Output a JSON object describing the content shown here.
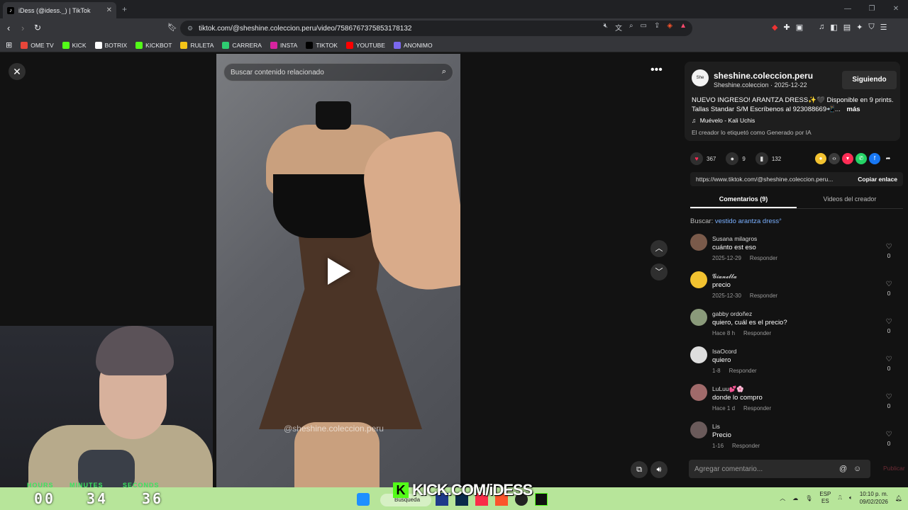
{
  "browser": {
    "tab_title": "iDess (@idess._) | TikTok",
    "url": "tiktok.com/@sheshine.coleccion.peru/video/7586767375853178132"
  },
  "bookmarks": [
    {
      "label": "OME TV",
      "color": "#e8463a"
    },
    {
      "label": "KICK",
      "color": "#53fc18"
    },
    {
      "label": "BOTRIX",
      "color": "#ffffff"
    },
    {
      "label": "KICKBOT",
      "color": "#53fc18"
    },
    {
      "label": "RULETA",
      "color": "#f5c518"
    },
    {
      "label": "CARRERA",
      "color": "#2ecc71"
    },
    {
      "label": "INSTA",
      "color": "#d6249f"
    },
    {
      "label": "TIKTOK",
      "color": "#000000"
    },
    {
      "label": "YOUTUBE",
      "color": "#ff0000"
    },
    {
      "label": "ANONIMO",
      "color": "#7b68ee"
    }
  ],
  "video": {
    "search_placeholder": "Buscar contenido relacionado",
    "watermark": "@sheshine.coleccion.peru"
  },
  "post": {
    "username": "sheshine.coleccion.peru",
    "subline": "Sheshine.coleccion · 2025-12-22",
    "follow_label": "Siguiendo",
    "avatar_text": "She Shine",
    "description": "NUEVO INGRESO! ARANTZA DRESS✨🖤 Disponible en 9 prints. Tallas Standar S/M Escríbenos al 923088669📲...",
    "more_label": "más",
    "music": "Muévelo - Kali Uchis",
    "ai_label": "El creador lo etiquetó como Generado por IA",
    "likes": "367",
    "comments": "9",
    "saves": "132",
    "link": "https://www.tiktok.com/@sheshine.coleccion.peru...",
    "copy_label": "Copiar enlace"
  },
  "tabs": {
    "comments": "Comentarios (9)",
    "creator_videos": "Videos del creador"
  },
  "search_suggest": {
    "prefix": "Buscar:",
    "term": "vestido arantza dress"
  },
  "comments": [
    {
      "name": "Susana milagros",
      "text": "cuánto est eso",
      "date": "2025-12-29",
      "reply": "Responder",
      "likes": "0",
      "avatar_color": "#7a5a4a"
    },
    {
      "name": "𝓖𝓲𝓪𝓷𝓮𝓵𝓵𝓪",
      "text": "precio",
      "date": "2025-12-30",
      "reply": "Responder",
      "likes": "0",
      "avatar_color": "#f2c230"
    },
    {
      "name": "gabby ordoñez",
      "text": "quiero, cuál es el precio?",
      "date": "Hace 8 h",
      "reply": "Responder",
      "likes": "0",
      "avatar_color": "#8a9a7a"
    },
    {
      "name": "IsaOcord",
      "text": "quiero",
      "date": "1-8",
      "reply": "Responder",
      "likes": "0",
      "avatar_color": "#dddddd"
    },
    {
      "name": "LuLuu💕🌸",
      "text": "donde lo compro",
      "date": "Hace 1 d",
      "reply": "Responder",
      "likes": "0",
      "avatar_color": "#a06a6a"
    },
    {
      "name": "Lis",
      "text": "Precio",
      "date": "1-16",
      "reply": "Responder",
      "likes": "0",
      "avatar_color": "#6a5a5a"
    }
  ],
  "add_comment": {
    "placeholder": "Agregar comentario...",
    "publish": "Publicar"
  },
  "stream": {
    "timer_labels": [
      "HOURS",
      "MINUTES",
      "SECONDS"
    ],
    "timer_values": [
      "00",
      "34",
      "36"
    ],
    "banner": "KICK.COM/iDESS"
  },
  "taskbar": {
    "search_label": "Búsqueda",
    "lang_top": "ESP",
    "lang_bottom": "ES",
    "time": "10:10 p. m.",
    "date": "09/02/2026"
  }
}
